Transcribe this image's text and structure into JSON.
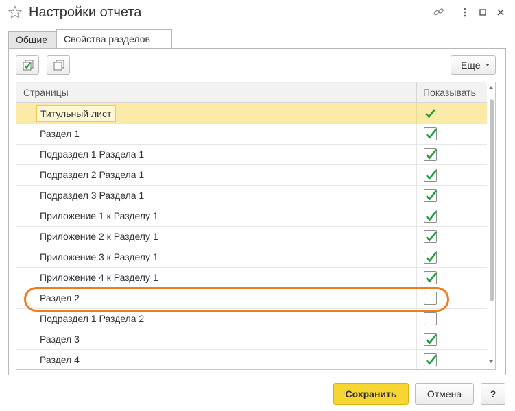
{
  "window": {
    "title": "Настройки отчета"
  },
  "tabs": [
    {
      "label": "Общие",
      "active": false
    },
    {
      "label": "Свойства разделов",
      "active": true
    }
  ],
  "toolbar": {
    "check_all_icon": "check-all-icon",
    "uncheck_all_icon": "uncheck-all-icon",
    "more_label": "Еще"
  },
  "table": {
    "columns": [
      "Страницы",
      "Показывать"
    ],
    "rows": [
      {
        "name": "Титульный лист",
        "show": true,
        "selected": true
      },
      {
        "name": "Раздел 1",
        "show": true
      },
      {
        "name": "Подраздел 1 Раздела 1",
        "show": true
      },
      {
        "name": "Подраздел 2 Раздела 1",
        "show": true
      },
      {
        "name": "Подраздел 3 Раздела 1",
        "show": true
      },
      {
        "name": "Приложение 1 к Разделу 1",
        "show": true
      },
      {
        "name": "Приложение 2 к Разделу 1",
        "show": true
      },
      {
        "name": "Приложение 3 к Разделу 1",
        "show": true
      },
      {
        "name": "Приложение 4 к Разделу 1",
        "show": true
      },
      {
        "name": "Раздел 2",
        "show": false,
        "highlighted": true
      },
      {
        "name": "Подраздел 1 Раздела 2",
        "show": false
      },
      {
        "name": "Раздел 3",
        "show": true
      },
      {
        "name": "Раздел 4",
        "show": true
      }
    ]
  },
  "buttons": {
    "save": "Сохранить",
    "cancel": "Отмена",
    "help": "?"
  },
  "colors": {
    "check_green": "#1a9e3a",
    "selected_row": "#fbeaa8",
    "highlight_orange": "#f07c1d",
    "save_yellow": "#f7d532"
  }
}
